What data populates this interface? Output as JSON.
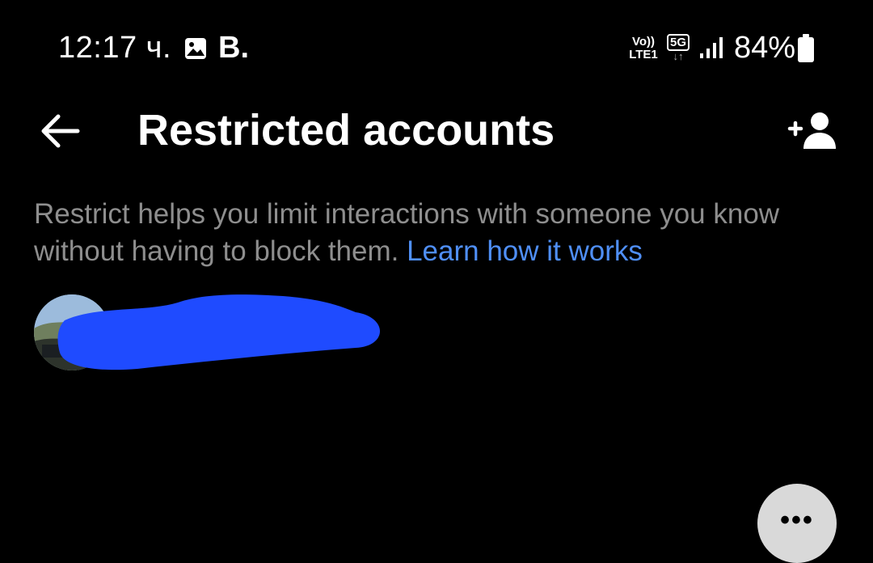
{
  "status_bar": {
    "time": "12:17 ч.",
    "app_letter": "B.",
    "volte_top": "Vo))",
    "volte_bottom": "LTE1",
    "network_type": "5G",
    "network_arrows": "↓↑",
    "battery_percent": "84%",
    "icons": [
      "gallery-icon",
      "signal-icon",
      "battery-icon"
    ]
  },
  "header": {
    "title": "Restricted accounts",
    "back_icon": "arrow-left-icon",
    "add_icon": "add-person-icon"
  },
  "description": {
    "text": "Restrict helps you limit interactions with someone you know without having to block them. ",
    "link_text": "Learn how it works"
  },
  "accounts": [
    {
      "avatar": "avatar-photo",
      "name_redacted": true
    }
  ],
  "more_button": {
    "label": "•••",
    "icon": "more-horizontal-icon"
  },
  "colors": {
    "background": "#000000",
    "text_primary": "#ffffff",
    "text_secondary": "#8e8e8e",
    "link": "#4f8ff7",
    "redaction": "#1f4bff",
    "more_button_bg": "#d9d9d9"
  }
}
